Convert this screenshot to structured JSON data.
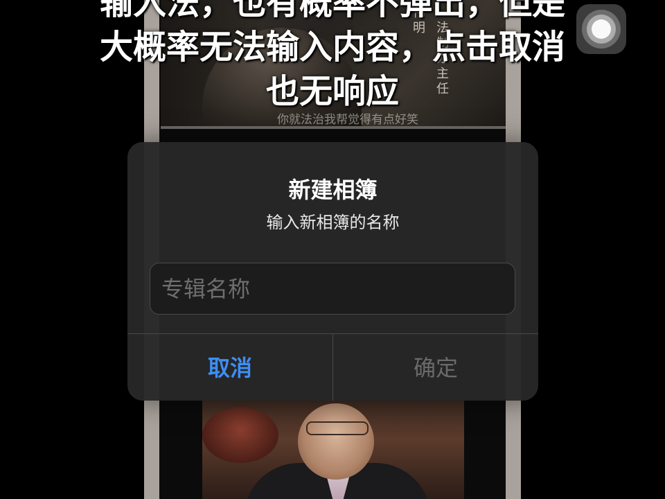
{
  "overlay_caption": {
    "line1": "输入法，也有概率不弹出，但是",
    "line2": "大概率无法输入内容，点击取消",
    "line3": "也无响应"
  },
  "background_video": {
    "top_vertical_text_1": "伟明",
    "top_vertical_text_2": "法制办主任",
    "top_subtitle": "你就法治我帮觉得有点好笑"
  },
  "alert": {
    "title": "新建相簿",
    "message": "输入新相簿的名称",
    "input_placeholder": "专辑名称",
    "input_value": "",
    "cancel_label": "取消",
    "confirm_label": "确定",
    "cancel_color": "#3d8ef5",
    "confirm_color_disabled": "#6a6a6a"
  },
  "assistive_touch": {
    "icon": "assistive-touch-icon"
  }
}
